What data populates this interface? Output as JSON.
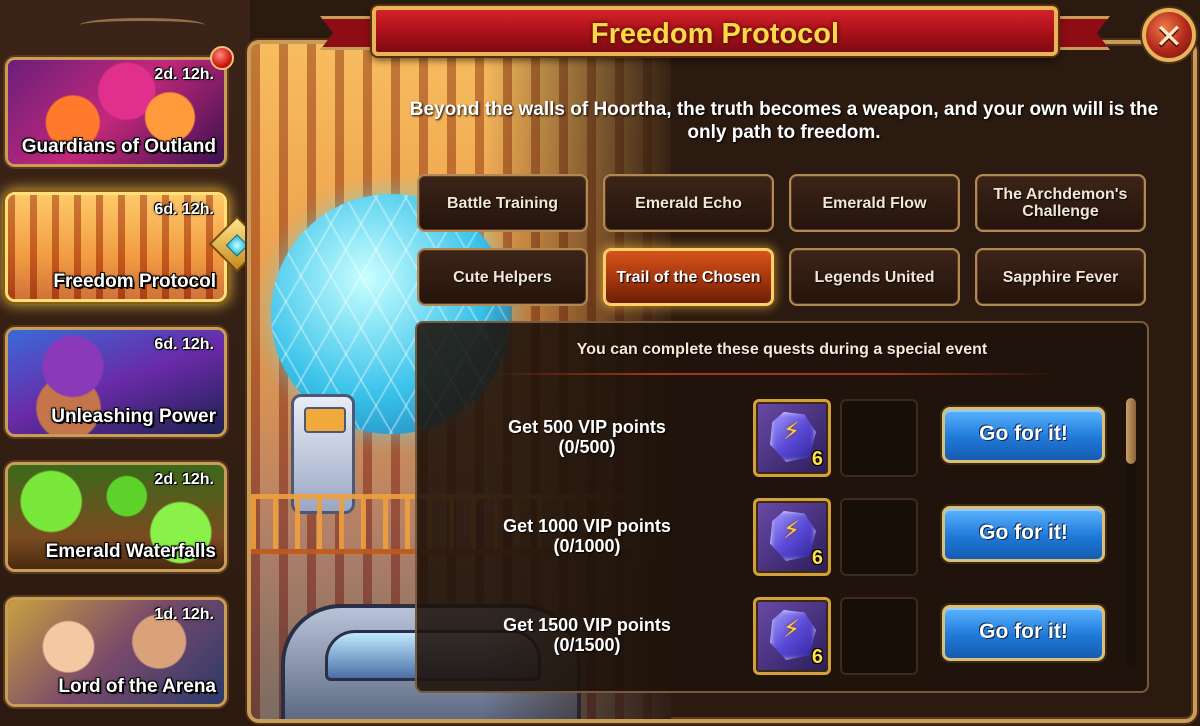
{
  "sidebar": {
    "events": [
      {
        "title": "Guardians of Outland",
        "time": "2d. 12h."
      },
      {
        "title": "Freedom Protocol",
        "time": "6d. 12h."
      },
      {
        "title": "Unleashing Power",
        "time": "6d. 12h."
      },
      {
        "title": "Emerald Waterfalls",
        "time": "2d. 12h."
      },
      {
        "title": "Lord of the Arena",
        "time": "1d. 12h."
      }
    ]
  },
  "window": {
    "title": "Freedom Protocol",
    "description": "Beyond the walls of Hoortha, the truth becomes a weapon, and your own will is the only path to freedom."
  },
  "tabs": [
    {
      "label": "Battle Training"
    },
    {
      "label": "Emerald Echo"
    },
    {
      "label": "Emerald Flow"
    },
    {
      "label": "The Archdemon's Challenge"
    },
    {
      "label": "Cute Helpers"
    },
    {
      "label": "Trail of the Chosen",
      "active": true
    },
    {
      "label": "Legends United"
    },
    {
      "label": "Sapphire Fever"
    }
  ],
  "quests": {
    "header": "You can complete these quests during a special event",
    "items": [
      {
        "title": "Get 500 VIP points",
        "progress": "(0/500)",
        "reward_count": "6",
        "reward_icon": "lightning-gem-icon",
        "button": "Go for it!"
      },
      {
        "title": "Get 1000 VIP points",
        "progress": "(0/1000)",
        "reward_count": "6",
        "reward_icon": "lightning-gem-icon",
        "button": "Go for it!"
      },
      {
        "title": "Get 1500 VIP points",
        "progress": "(0/1500)",
        "reward_count": "6",
        "reward_icon": "lightning-gem-icon",
        "button": "Go for it!"
      }
    ]
  },
  "colors": {
    "accent_gold": "#c99c58",
    "banner_red": "#a50f18",
    "title_yellow": "#ffd84a",
    "button_blue": "#1f79d8",
    "active_tab": "#d8541c"
  }
}
